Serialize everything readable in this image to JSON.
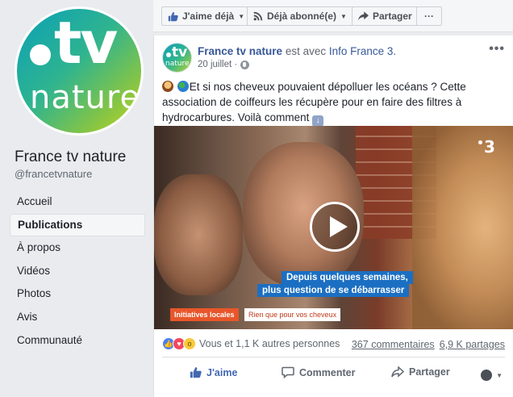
{
  "page": {
    "name": "France tv nature",
    "handle": "@francetvnature",
    "logo": {
      "tv": "tv",
      "nature": "nature"
    }
  },
  "sidebar": {
    "items": [
      {
        "label": "Accueil",
        "active": false
      },
      {
        "label": "Publications",
        "active": true
      },
      {
        "label": "À propos",
        "active": false
      },
      {
        "label": "Vidéos",
        "active": false
      },
      {
        "label": "Photos",
        "active": false
      },
      {
        "label": "Avis",
        "active": false
      },
      {
        "label": "Communauté",
        "active": false
      }
    ]
  },
  "topbar": {
    "like_label": "J'aime déjà",
    "follow_label": "Déjà abonné(e)",
    "share_label": "Partager",
    "more_label": "···"
  },
  "post": {
    "author": "France tv nature",
    "with_text": "est avec",
    "tagged": "Info France 3.",
    "date": "20 juillet",
    "more_label": "•••",
    "text_line": "Et si nos cheveux pouvaient dépolluer les océans ? Cette association de coiffeurs les récupère pour en faire des filtres à hydrocarbures. Voilà comment",
    "video": {
      "channel": "3",
      "subtitle_1": "Depuis quelques semaines,",
      "subtitle_2": "plus question de se débarrasser",
      "tag_1": "Initiatives locales",
      "tag_2": "Rien que pour vos cheveux"
    },
    "reactions_text": "Vous et 1,1 K autres personnes",
    "comments_count": "367 commentaires",
    "shares_count": "6,9 K partages",
    "actions": {
      "like": "J'aime",
      "comment": "Commenter",
      "share": "Partager"
    }
  },
  "colors": {
    "link": "#385898",
    "facebook_blue": "#4267b2",
    "subtitle_bg": "#1b6fc2",
    "tag_orange": "#e8562a"
  }
}
